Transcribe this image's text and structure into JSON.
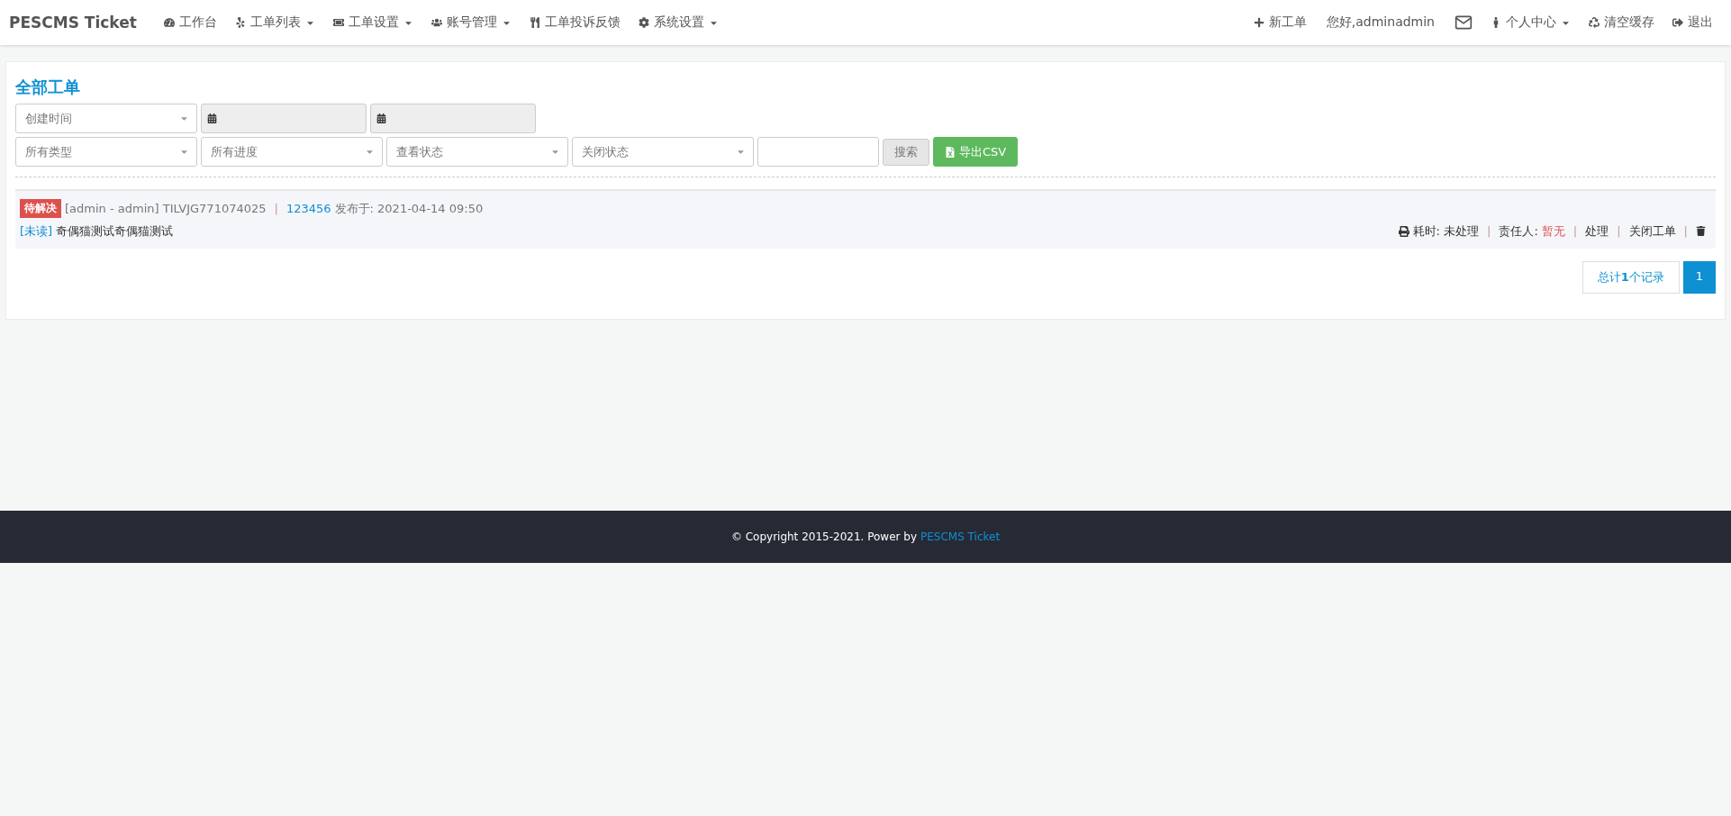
{
  "navbar": {
    "brand": "PESCMS Ticket",
    "left_items": [
      {
        "label": "工作台",
        "dropdown": false
      },
      {
        "label": "工单列表",
        "dropdown": true
      },
      {
        "label": "工单设置",
        "dropdown": true
      },
      {
        "label": "账号管理",
        "dropdown": true
      },
      {
        "label": "工单投诉反馈",
        "dropdown": false
      },
      {
        "label": "系统设置",
        "dropdown": true
      }
    ],
    "right_items": [
      {
        "kind": "link",
        "label": "新工单",
        "dropdown": false
      },
      {
        "kind": "text",
        "label": "您好,adminadmin"
      },
      {
        "kind": "mail"
      },
      {
        "kind": "link",
        "label": "个人中心",
        "dropdown": true
      },
      {
        "kind": "link",
        "label": "清空缓存",
        "dropdown": false
      },
      {
        "kind": "link",
        "label": "退出",
        "dropdown": false
      }
    ]
  },
  "panel": {
    "title": "全部工单",
    "filters_row1": [
      {
        "kind": "select",
        "value": "创建时间"
      },
      {
        "kind": "date",
        "readonly": true
      },
      {
        "kind": "date",
        "readonly": true
      }
    ],
    "filters_row2": [
      {
        "kind": "select",
        "value": "所有类型"
      },
      {
        "kind": "select",
        "value": "所有进度"
      },
      {
        "kind": "select",
        "value": "查看状态"
      },
      {
        "kind": "select",
        "value": "关闭状态"
      },
      {
        "kind": "input"
      },
      {
        "kind": "search",
        "label": "搜索"
      },
      {
        "kind": "export",
        "label": "导出CSV"
      }
    ],
    "tickets": [
      {
        "status": "待解决",
        "meta": "[admin - admin] TILVJG771074025",
        "separator": "|",
        "number": "123456",
        "posted": "发布于: 2021-04-14 09:50",
        "read_tag": "[未读]",
        "title": "奇偶猫测试奇偶猫测试",
        "time_label": "耗时: 未处理",
        "owner_label": "责任人:",
        "owner": "暂无",
        "actions": [
          "处理",
          "关闭工单"
        ]
      }
    ],
    "pagination": {
      "total": "总计**1**个记录",
      "pages": [
        {
          "label": "1",
          "selected": true
        }
      ]
    }
  },
  "footer": {
    "copyright": "© Copyright 2015-2021. Power by",
    "link": "PESCMS Ticket"
  }
}
